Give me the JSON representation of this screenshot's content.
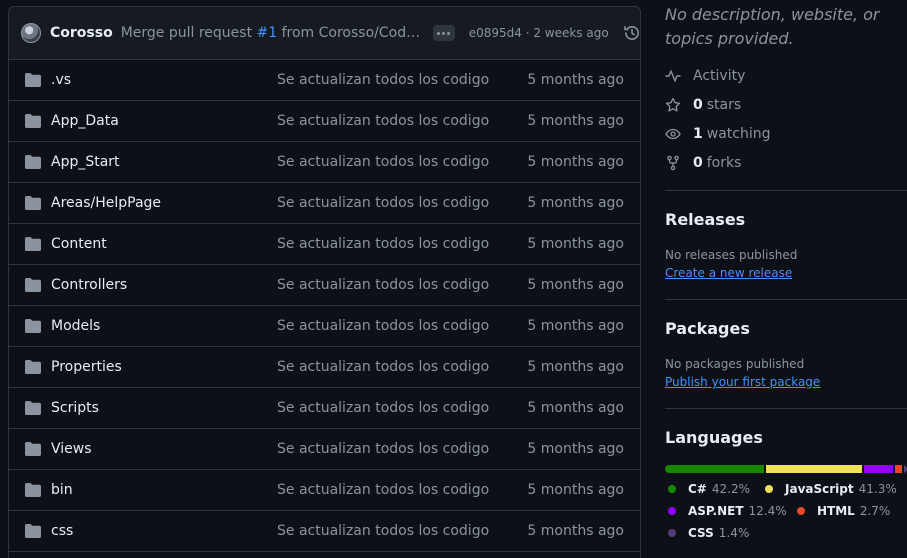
{
  "commit": {
    "author": "Corosso",
    "message_prefix": "Merge pull request ",
    "pr": "#1",
    "message_suffix": " from Corosso/Codigo...",
    "meta": "e0895d4 · 2 weeks ago",
    "icons": {
      "avatar": "avatar",
      "more": "kebab-horizontal-icon",
      "history": "history-icon"
    }
  },
  "files": [
    {
      "name": ".vs",
      "message": "Se actualizan todos los codigo",
      "age": "5 months ago"
    },
    {
      "name": "App_Data",
      "message": "Se actualizan todos los codigo",
      "age": "5 months ago"
    },
    {
      "name": "App_Start",
      "message": "Se actualizan todos los codigo",
      "age": "5 months ago"
    },
    {
      "name": "Areas/HelpPage",
      "message": "Se actualizan todos los codigo",
      "age": "5 months ago"
    },
    {
      "name": "Content",
      "message": "Se actualizan todos los codigo",
      "age": "5 months ago"
    },
    {
      "name": "Controllers",
      "message": "Se actualizan todos los codigo",
      "age": "5 months ago"
    },
    {
      "name": "Models",
      "message": "Se actualizan todos los codigo",
      "age": "5 months ago"
    },
    {
      "name": "Properties",
      "message": "Se actualizan todos los codigo",
      "age": "5 months ago"
    },
    {
      "name": "Scripts",
      "message": "Se actualizan todos los codigo",
      "age": "5 months ago"
    },
    {
      "name": "Views",
      "message": "Se actualizan todos los codigo",
      "age": "5 months ago"
    },
    {
      "name": "bin",
      "message": "Se actualizan todos los codigo",
      "age": "5 months ago"
    },
    {
      "name": "css",
      "message": "Se actualizan todos los codigo",
      "age": "5 months ago"
    }
  ],
  "about": {
    "description": "No description, website, or topics provided.",
    "activity": "Activity",
    "stars_count": "0",
    "stars_label": "stars",
    "watching_count": "1",
    "watching_label": "watching",
    "forks_count": "0",
    "forks_label": "forks"
  },
  "releases": {
    "title": "Releases",
    "note": "No releases published",
    "link": "Create a new release"
  },
  "packages": {
    "title": "Packages",
    "note": "No packages published",
    "link": "Publish your first package"
  },
  "languages": {
    "title": "Languages",
    "items": [
      {
        "name": "C#",
        "percent": "42.2%",
        "value": 42.2,
        "color": "#178600"
      },
      {
        "name": "JavaScript",
        "percent": "41.3%",
        "value": 41.3,
        "color": "#f1e05a"
      },
      {
        "name": "ASP.NET",
        "percent": "12.4%",
        "value": 12.4,
        "color": "#9400ff"
      },
      {
        "name": "HTML",
        "percent": "2.7%",
        "value": 2.7,
        "color": "#e34c26"
      },
      {
        "name": "CSS",
        "percent": "1.4%",
        "value": 1.4,
        "color": "#563d7c"
      }
    ]
  }
}
